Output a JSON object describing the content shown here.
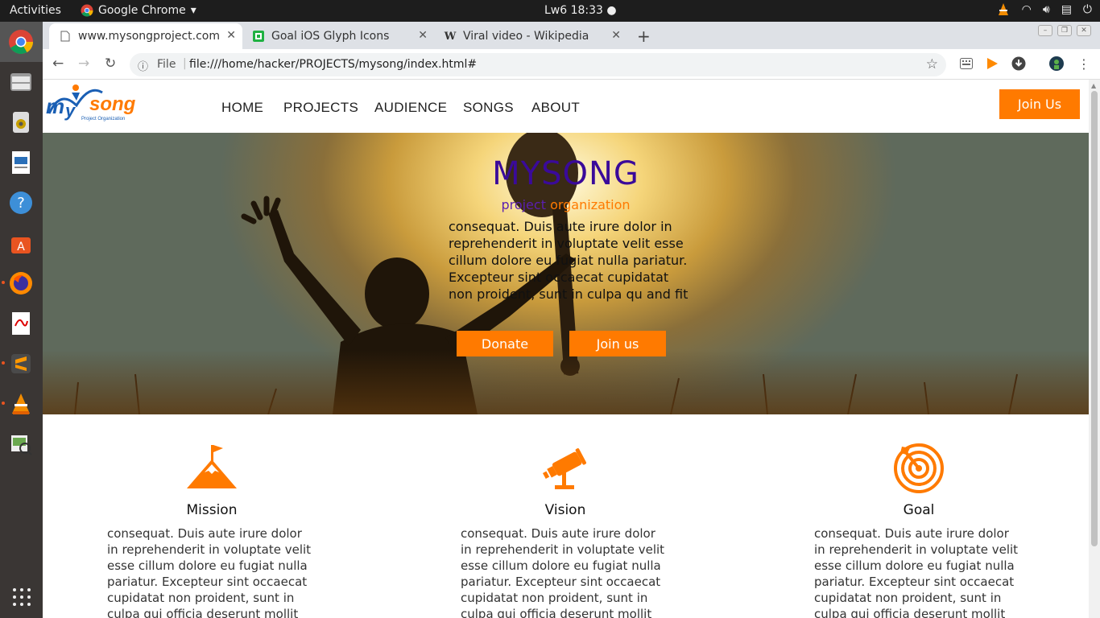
{
  "os": {
    "activities": "Activities",
    "app_name": "Google Chrome",
    "clock": "Lw6 18:33"
  },
  "browser": {
    "tabs": [
      {
        "title": "www.mysongproject.com",
        "favicon": "page-icon",
        "active": true
      },
      {
        "title": "Goal iOS Glyph Icons",
        "favicon": "icons8-icon",
        "active": false
      },
      {
        "title": "Viral video - Wikipedia",
        "favicon": "wikipedia-icon",
        "active": false
      }
    ],
    "omnibox": {
      "scheme_label": "File",
      "url": "file:///home/hacker/PROJECTS/mysong/index.html#"
    }
  },
  "site": {
    "logo": {
      "word": "mysong",
      "tagline": "Project Organization"
    },
    "nav": [
      "HOME",
      "PROJECTS",
      "AUDIENCE",
      "SONGS",
      "ABOUT"
    ],
    "join_top": "Join Us",
    "hero": {
      "title": "MYSONG",
      "subtitle_part1": "project",
      "subtitle_part2": "organization",
      "text": "consequat. Duis aute irure dolor in reprehenderit in voluptate velit esse cillum dolore eu fugiat nulla pariatur. Excepteur sint occaecat cupidatat non proident, sunt in culpa qu and fit",
      "donate": "Donate",
      "join_us": "Join us"
    },
    "features": [
      {
        "icon": "mountain-flag-icon",
        "title": "Mission",
        "text": "consequat. Duis aute irure dolor in reprehenderit in voluptate velit esse cillum dolore eu fugiat nulla pariatur. Excepteur sint occaecat cupidatat non proident, sunt in culpa qui officia deserunt mollit"
      },
      {
        "icon": "telescope-icon",
        "title": "Vision",
        "text": "consequat. Duis aute irure dolor in reprehenderit in voluptate velit esse cillum dolore eu fugiat nulla pariatur. Excepteur sint occaecat cupidatat non proident, sunt in culpa qui officia deserunt mollit"
      },
      {
        "icon": "target-icon",
        "title": "Goal",
        "text": "consequat. Duis aute irure dolor in reprehenderit in voluptate velit esse cillum dolore eu fugiat nulla pariatur. Excepteur sint occaecat cupidatat non proident, sunt in culpa qui officia deserunt mollit"
      }
    ],
    "colors": {
      "accent": "#ff7a00",
      "title": "#3a0a9a",
      "sub": "#5b1fb0"
    }
  }
}
